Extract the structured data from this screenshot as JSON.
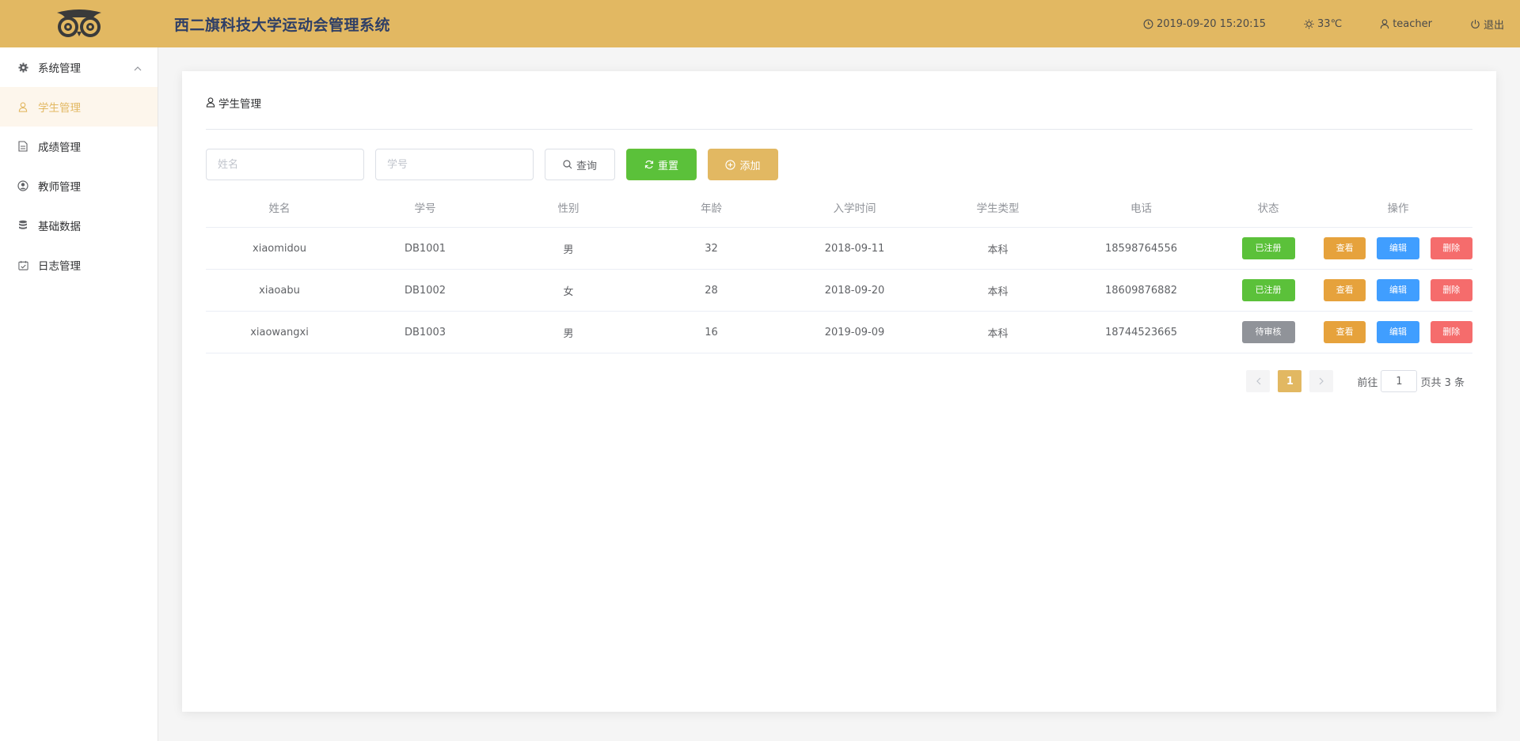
{
  "header": {
    "title": "西二旗科技大学运动会管理系统",
    "datetime": "2019-09-20 15:20:15",
    "weather": "33℃",
    "user": "teacher",
    "logout": "退出",
    "brand_color": "#e2b862"
  },
  "sidebar": {
    "items": [
      {
        "label": "系统管理",
        "icon": "gear-icon"
      },
      {
        "label": "学生管理",
        "icon": "user-icon",
        "active": true
      },
      {
        "label": "成绩管理",
        "icon": "document-icon"
      },
      {
        "label": "教师管理",
        "icon": "user-circle-icon"
      },
      {
        "label": "基础数据",
        "icon": "database-icon"
      },
      {
        "label": "日志管理",
        "icon": "calendar-check-icon"
      }
    ]
  },
  "page": {
    "title": "学生管理"
  },
  "toolbar": {
    "name_placeholder": "姓名",
    "id_placeholder": "学号",
    "query_label": "查询",
    "reset_label": "重置",
    "add_label": "添加"
  },
  "table": {
    "headers": [
      "姓名",
      "学号",
      "性别",
      "年龄",
      "入学时间",
      "学生类型",
      "电话",
      "状态",
      "操作"
    ],
    "rows": [
      {
        "name": "xiaomidou",
        "id": "DB1001",
        "gender": "男",
        "age": "32",
        "enroll": "2018-09-11",
        "type": "本科",
        "phone": "18598764556",
        "status": "已注册",
        "status_kind": "ok"
      },
      {
        "name": "xiaoabu",
        "id": "DB1002",
        "gender": "女",
        "age": "28",
        "enroll": "2018-09-20",
        "type": "本科",
        "phone": "18609876882",
        "status": "已注册",
        "status_kind": "ok"
      },
      {
        "name": "xiaowangxi",
        "id": "DB1003",
        "gender": "男",
        "age": "16",
        "enroll": "2019-09-09",
        "type": "本科",
        "phone": "18744523665",
        "status": "待审核",
        "status_kind": "wait"
      }
    ],
    "actions": {
      "view": "查看",
      "edit": "编辑",
      "delete": "删除"
    }
  },
  "pagination": {
    "current_page": "1",
    "goto_prefix": "前往",
    "goto_value": "1",
    "goto_suffix": "页",
    "total_text": "共 3 条"
  }
}
